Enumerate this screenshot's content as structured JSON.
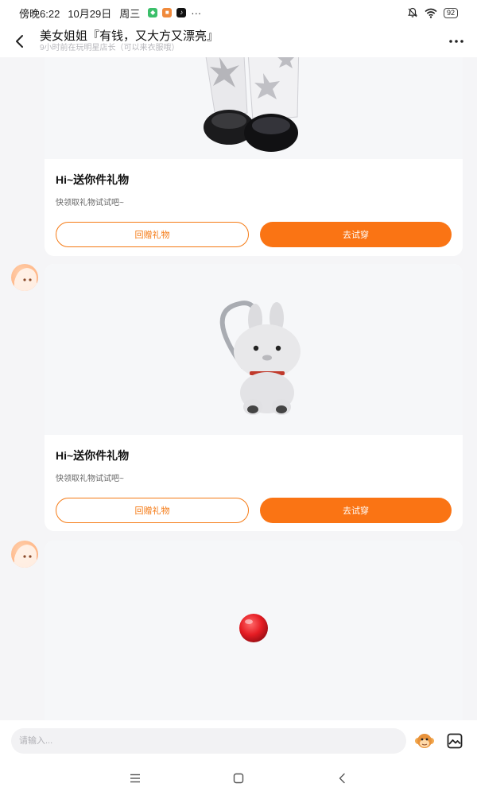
{
  "status_bar": {
    "time": "傍晚6:22",
    "date": "10月29日",
    "weekday": "周三",
    "more": "···",
    "battery": "92"
  },
  "header": {
    "title": "美女姐姐『有钱，又大方又漂亮』",
    "subtitle": "9小时前在玩明星店长（可以来衣服哦）"
  },
  "messages": [
    {
      "title": "Hi~送你件礼物",
      "desc": "快领取礼物试试吧~",
      "return_gift": "回赠礼物",
      "try_on": "去试穿",
      "item": "boots-image"
    },
    {
      "title": "Hi~送你件礼物",
      "desc": "快领取礼物试试吧~",
      "return_gift": "回赠礼物",
      "try_on": "去试穿",
      "item": "bunny-backpack-image"
    },
    {
      "item": "red-ball-image"
    }
  ],
  "input": {
    "placeholder": "请输入..."
  },
  "colors": {
    "accent": "#fa7414",
    "background": "#f5f5f7"
  }
}
